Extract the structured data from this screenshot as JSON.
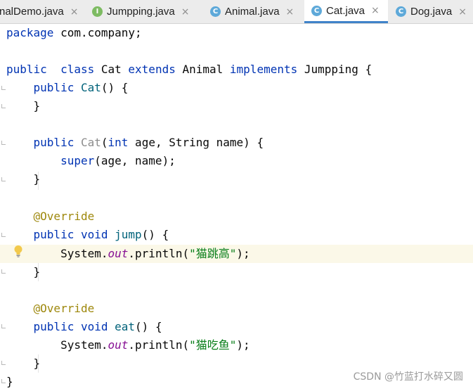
{
  "tabs": [
    {
      "label": "nalDemo.java",
      "kind": "none",
      "close": "×"
    },
    {
      "label": "Jumpping.java",
      "kind": "interface",
      "icon_letter": "I",
      "close": "×"
    },
    {
      "label": "Animal.java",
      "kind": "class",
      "icon_letter": "C",
      "close": "×"
    },
    {
      "label": "Cat.java",
      "kind": "class",
      "icon_letter": "C",
      "close": "×",
      "active": true
    },
    {
      "label": "Dog.java",
      "kind": "class",
      "icon_letter": "C",
      "close": "×"
    }
  ],
  "code": {
    "l1": {
      "kw": "package",
      "rest": " com.company;"
    },
    "l3": {
      "kw1": "public",
      "kw2": "class",
      "name": " Cat ",
      "kw3": "extends",
      "parent": " Animal ",
      "kw4": "implements",
      "iface": " Jumpping {"
    },
    "l4": {
      "kw": "public",
      "name": "Cat",
      "rest": "() {"
    },
    "l5": "}",
    "l7": {
      "kw": "public",
      "name": "Cat",
      "p1": "(",
      "type": "int",
      "rest": " age, String name) {"
    },
    "l8": {
      "kw": "super",
      "rest": "(age, name);"
    },
    "l9": "}",
    "l11": "@Override",
    "l12": {
      "kw1": "public",
      "kw2": "void",
      "name": "jump",
      "rest": "() {"
    },
    "l13": {
      "obj": "System.",
      "field": "out",
      "call": ".println(",
      "str": "\"猫跳高\"",
      "end": ");"
    },
    "l14": "}",
    "l16": "@Override",
    "l17": {
      "kw1": "public",
      "kw2": "void",
      "name": "eat",
      "rest": "() {"
    },
    "l18": {
      "obj": "System.",
      "field": "out",
      "call": ".println(",
      "str": "\"猫吃鱼\"",
      "end": ");"
    },
    "l19": "}",
    "l20": "}"
  },
  "colors": {
    "keyword": "#0033b3",
    "method": "#00627a",
    "annotation": "#9e880d",
    "string": "#067d17",
    "field": "#871094",
    "active_tab_underline": "#4083c9",
    "line_highlight": "#fbf8e8"
  },
  "icons": {
    "gutter_hint": "lightbulb-icon"
  },
  "watermark": "CSDN @竹蓝打水碎又圆"
}
